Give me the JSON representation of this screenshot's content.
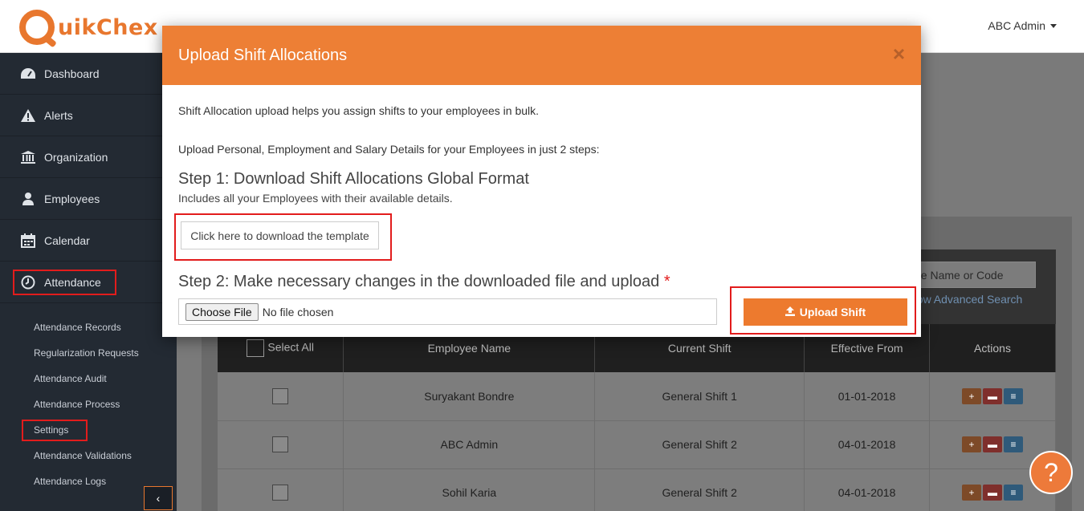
{
  "app": {
    "logo_text": "uikChex",
    "user_name": "ABC Admin"
  },
  "sidebar": {
    "items": [
      {
        "label": "Dashboard",
        "icon": "dashboard-icon"
      },
      {
        "label": "Alerts",
        "icon": "alert-icon"
      },
      {
        "label": "Organization",
        "icon": "bank-icon"
      },
      {
        "label": "Employees",
        "icon": "user-icon"
      },
      {
        "label": "Calendar",
        "icon": "calendar-icon"
      },
      {
        "label": "Attendance",
        "icon": "clock-icon"
      }
    ],
    "sub_items": [
      "Attendance Records",
      "Regularization Requests",
      "Attendance Audit",
      "Attendance Process",
      "Settings",
      "Attendance Validations",
      "Attendance Logs"
    ],
    "collapse_glyph": "‹"
  },
  "filter": {
    "search_placeholder": "ee Name or Code",
    "advanced_search": "how Advanced Search"
  },
  "table": {
    "select_all": "Select All",
    "headers": [
      "Employee Name",
      "Current Shift",
      "Effective From",
      "Actions"
    ],
    "rows": [
      {
        "name": "Suryakant Bondre",
        "shift": "General Shift 1",
        "from": "01-01-2018"
      },
      {
        "name": "ABC Admin",
        "shift": "General Shift 2",
        "from": "04-01-2018"
      },
      {
        "name": "Sohil Karia",
        "shift": "General Shift 2",
        "from": "04-01-2018"
      }
    ]
  },
  "modal": {
    "title": "Upload Shift Allocations",
    "close": "×",
    "intro": "Shift Allocation upload helps you assign shifts to your employees in bulk.",
    "steps_intro": "Upload Personal, Employment and Salary Details for your Employees in just 2 steps:",
    "step1_title": "Step 1: Download Shift Allocations Global Format",
    "step1_sub": "Includes all your Employees with their available details.",
    "download_label": "Click here to download the template",
    "step2_title": "Step 2: Make necessary changes in the downloaded file and upload",
    "required_mark": "*",
    "choose_file": "Choose File",
    "no_file": "No file chosen",
    "upload_label": "Upload Shift"
  },
  "help": {
    "glyph": "?"
  },
  "colors": {
    "accent": "#ed7f35",
    "highlight": "#e21c1c",
    "sidebar": "#232a33"
  }
}
